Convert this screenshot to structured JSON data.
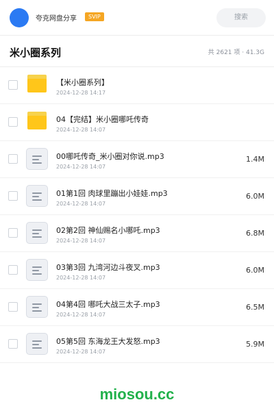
{
  "header": {
    "share_name": "夸克网盘分享",
    "badge": "SVIP",
    "search_label": "搜索"
  },
  "folder": {
    "title": "米小圈系列",
    "summary": "共 2621 项 · 41.3G"
  },
  "items": [
    {
      "type": "folder",
      "name": "【米小圈系列】",
      "date": "2024-12-28 14:17",
      "size": ""
    },
    {
      "type": "folder",
      "name": "04【完结】米小圈哪吒传奇",
      "date": "2024-12-28 14:07",
      "size": ""
    },
    {
      "type": "file",
      "name": "00哪吒传奇_米小圈对你说.mp3",
      "date": "2024-12-28 14:07",
      "size": "1.4M"
    },
    {
      "type": "file",
      "name": "01第1回 肉球里蹦出小娃娃.mp3",
      "date": "2024-12-28 14:07",
      "size": "6.0M"
    },
    {
      "type": "file",
      "name": "02第2回 神仙赐名小哪吒.mp3",
      "date": "2024-12-28 14:07",
      "size": "6.8M"
    },
    {
      "type": "file",
      "name": "03第3回 九湾河边斗夜叉.mp3",
      "date": "2024-12-28 14:07",
      "size": "6.0M"
    },
    {
      "type": "file",
      "name": "04第4回 哪吒大战三太子.mp3",
      "date": "2024-12-28 14:07",
      "size": "6.5M"
    },
    {
      "type": "file",
      "name": "05第5回 东海龙王大发怒.mp3",
      "date": "2024-12-28 14:07",
      "size": "5.9M"
    }
  ],
  "watermark": "miosou.cc",
  "colors": {
    "accent": "#2b7af3",
    "svip": "#f5a623",
    "folder": "#ffc61a",
    "watermark": "#22b14c"
  },
  "icons": {
    "folder": "folder-icon",
    "file": "document-icon"
  }
}
